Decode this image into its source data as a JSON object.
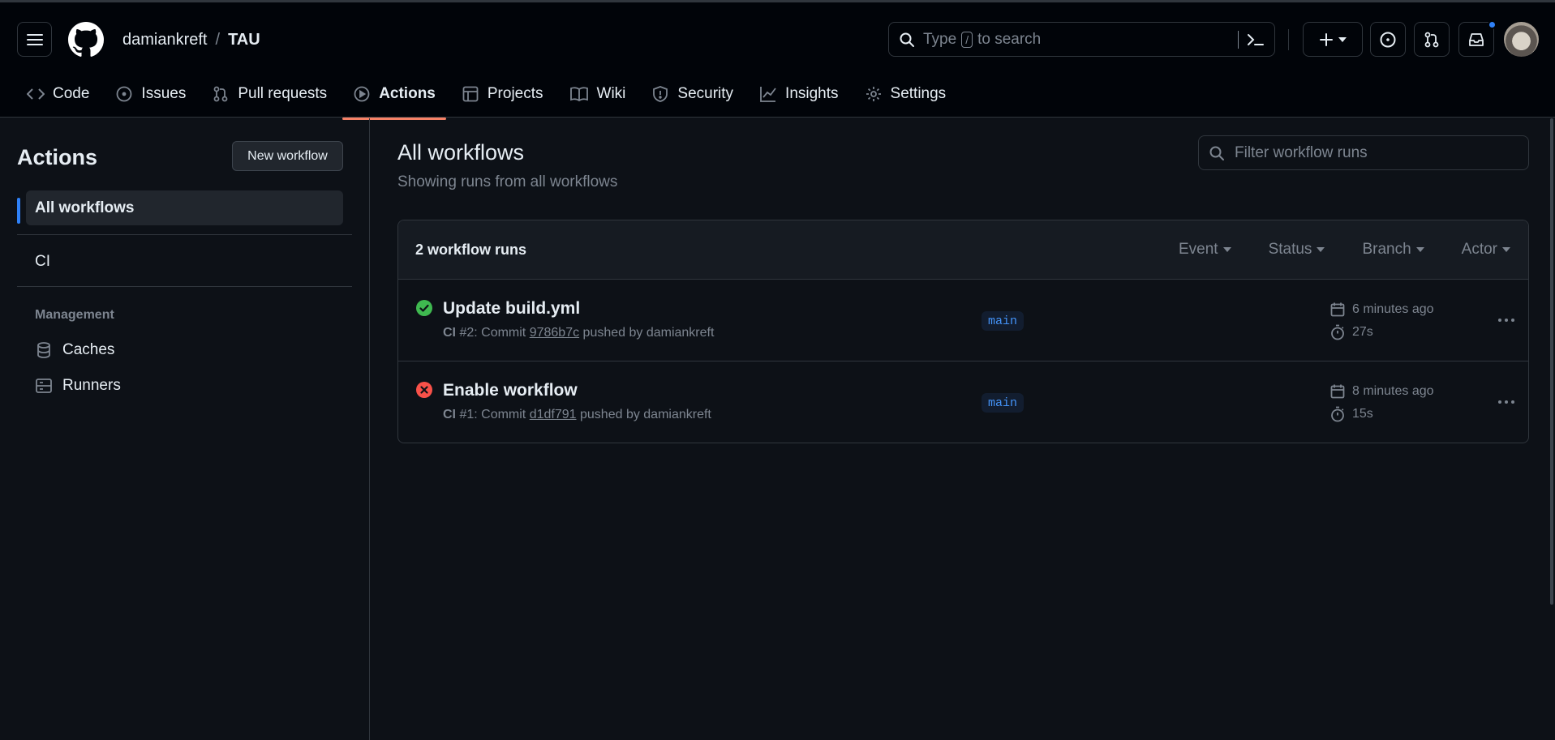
{
  "header": {
    "owner": "damiankreft",
    "separator": "/",
    "repo": "TAU",
    "search_placeholder_before": "Type",
    "search_key": "/",
    "search_placeholder_after": "to search"
  },
  "tabs": [
    {
      "label": "Code",
      "icon": "code-icon"
    },
    {
      "label": "Issues",
      "icon": "issue-opened-icon"
    },
    {
      "label": "Pull requests",
      "icon": "git-pull-request-icon"
    },
    {
      "label": "Actions",
      "icon": "play-icon",
      "active": true
    },
    {
      "label": "Projects",
      "icon": "table-icon"
    },
    {
      "label": "Wiki",
      "icon": "book-icon"
    },
    {
      "label": "Security",
      "icon": "shield-icon"
    },
    {
      "label": "Insights",
      "icon": "graph-icon"
    },
    {
      "label": "Settings",
      "icon": "gear-icon"
    }
  ],
  "sidebar": {
    "title": "Actions",
    "new_workflow_label": "New workflow",
    "items": [
      {
        "label": "All workflows",
        "selected": true
      },
      {
        "label": "CI"
      }
    ],
    "section_label": "Management",
    "management": [
      {
        "label": "Caches",
        "icon": "database-icon"
      },
      {
        "label": "Runners",
        "icon": "server-icon"
      }
    ]
  },
  "main": {
    "title": "All workflows",
    "subtitle": "Showing runs from all workflows",
    "filter_placeholder": "Filter workflow runs",
    "runs_count": "2 workflow runs",
    "filters": [
      "Event",
      "Status",
      "Branch",
      "Actor"
    ],
    "runs": [
      {
        "status": "success",
        "title": "Update build.yml",
        "workflow": "CI",
        "number": "#2",
        "commit_prefix": ": Commit",
        "sha": "9786b7c",
        "pushed_by": "pushed by damiankreft",
        "branch": "main",
        "time": "6 minutes ago",
        "duration": "27s"
      },
      {
        "status": "failure",
        "title": "Enable workflow",
        "workflow": "CI",
        "number": "#1",
        "commit_prefix": ": Commit",
        "sha": "d1df791",
        "pushed_by": "pushed by damiankreft",
        "branch": "main",
        "time": "8 minutes ago",
        "duration": "15s"
      }
    ]
  },
  "colors": {
    "accent": "#2f81f7",
    "success": "#3fb950",
    "failure": "#f85149",
    "tab_underline": "#f78166"
  }
}
